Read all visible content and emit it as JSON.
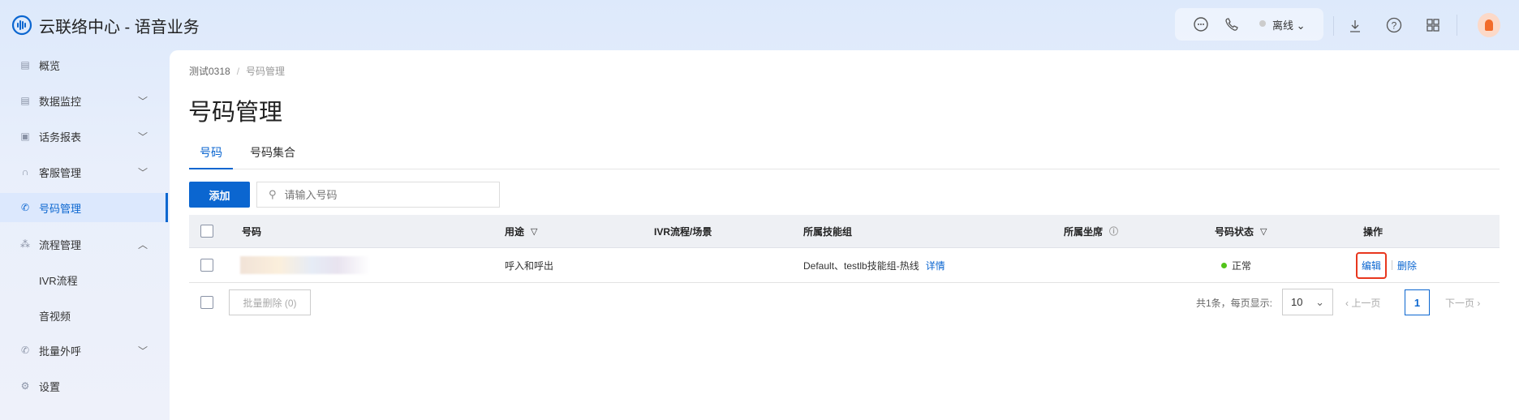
{
  "app": {
    "title": "云联络中心 - 语音业务"
  },
  "header": {
    "status": "离线",
    "icons": [
      "chat-icon",
      "phone-icon",
      "download-icon",
      "help-icon",
      "apps-grid-icon",
      "avatar"
    ]
  },
  "sidebar": {
    "items": [
      {
        "label": "概览",
        "icon": "overview-icon"
      },
      {
        "label": "数据监控",
        "icon": "monitor-icon",
        "chevron": "down"
      },
      {
        "label": "话务报表",
        "icon": "report-icon",
        "chevron": "down"
      },
      {
        "label": "客服管理",
        "icon": "headset-icon",
        "chevron": "down"
      },
      {
        "label": "号码管理",
        "icon": "phone-icon",
        "active": true
      },
      {
        "label": "流程管理",
        "icon": "flow-icon",
        "chevron": "up"
      },
      {
        "label": "IVR流程",
        "sub": true
      },
      {
        "label": "音视频",
        "sub": true
      },
      {
        "label": "批量外呼",
        "icon": "outbound-call-icon",
        "chevron": "down"
      },
      {
        "label": "设置",
        "icon": "gear-icon"
      }
    ]
  },
  "breadcrumb": [
    "测试0318",
    "号码管理"
  ],
  "page": {
    "title": "号码管理"
  },
  "tabs": [
    "号码",
    "号码集合"
  ],
  "toolbar": {
    "add_label": "添加",
    "search_placeholder": "请输入号码"
  },
  "table": {
    "columns": [
      "号码",
      "用途",
      "IVR流程/场景",
      "所属技能组",
      "所属坐席",
      "号码状态",
      "操作"
    ],
    "rows": [
      {
        "number": "",
        "usage": "呼入和呼出",
        "ivr": "",
        "skill_group": "Default、testlb技能组-热线",
        "detail": "详情",
        "agent": "",
        "status": "正常",
        "status_color": "#52c41a",
        "actions": [
          "编辑",
          "删除"
        ]
      }
    ]
  },
  "footer": {
    "batch_delete": "批量删除 (0)",
    "total": "共1条，每页显示:",
    "page_size": "10",
    "prev": "上一页",
    "page": "1",
    "next": "下一页"
  },
  "colors": {
    "accent": "#0b66d0",
    "highlight": "#e8371e"
  }
}
